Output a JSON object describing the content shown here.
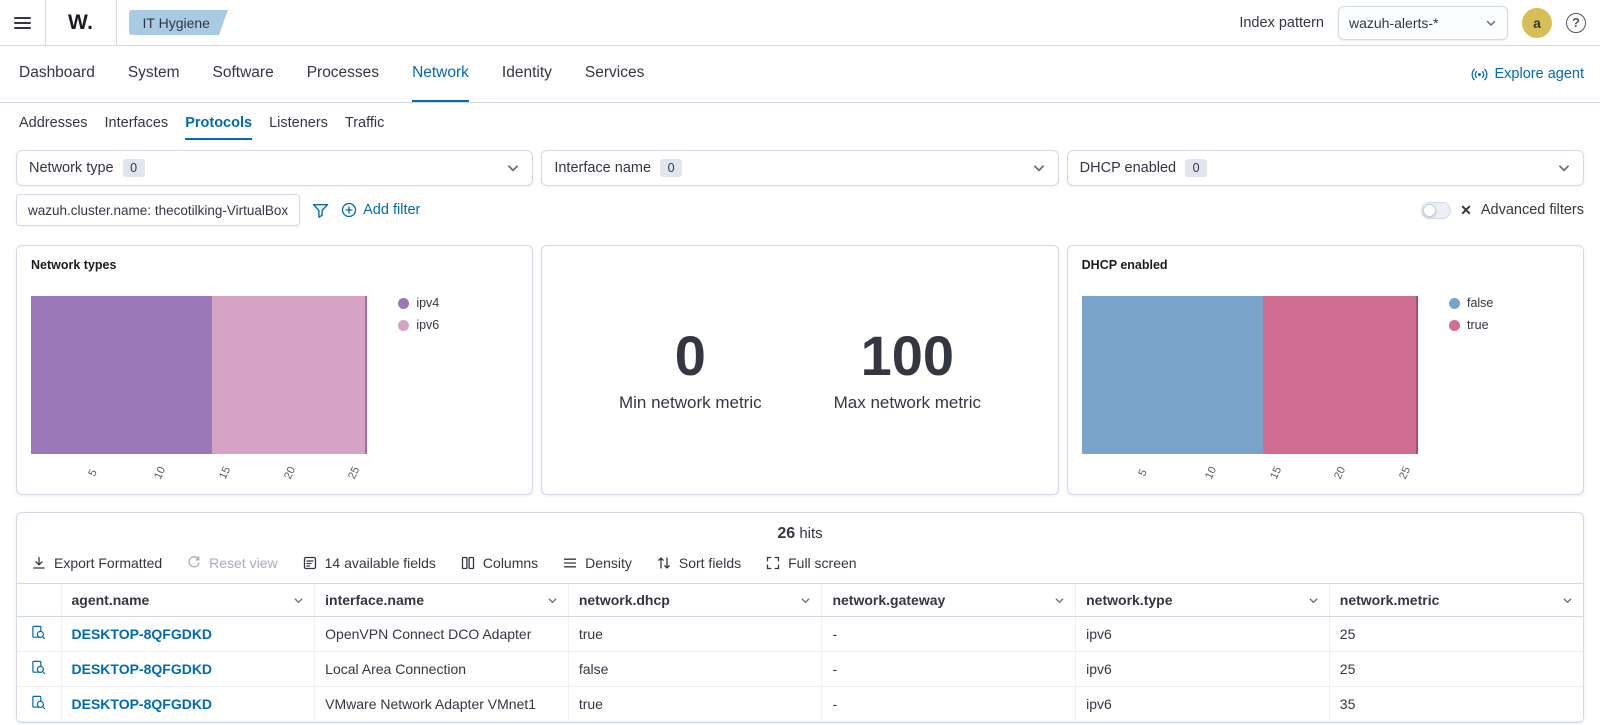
{
  "topbar": {
    "logo": "W.",
    "breadcrumb": "IT Hygiene",
    "index_pattern_label": "Index pattern",
    "index_pattern_value": "wazuh-alerts-*",
    "avatar_initial": "a",
    "help_glyph": "?"
  },
  "nav": {
    "tabs": [
      {
        "label": "Dashboard",
        "active": false
      },
      {
        "label": "System",
        "active": false
      },
      {
        "label": "Software",
        "active": false
      },
      {
        "label": "Processes",
        "active": false
      },
      {
        "label": "Network",
        "active": true
      },
      {
        "label": "Identity",
        "active": false
      },
      {
        "label": "Services",
        "active": false
      }
    ],
    "explore_agent_label": "Explore agent"
  },
  "subnav": {
    "tabs": [
      {
        "label": "Addresses",
        "active": false
      },
      {
        "label": "Interfaces",
        "active": false
      },
      {
        "label": "Protocols",
        "active": true
      },
      {
        "label": "Listeners",
        "active": false
      },
      {
        "label": "Traffic",
        "active": false
      }
    ]
  },
  "filters": {
    "dropdowns": [
      {
        "label": "Network type",
        "count": "0"
      },
      {
        "label": "Interface name",
        "count": "0"
      },
      {
        "label": "DHCP enabled",
        "count": "0"
      }
    ],
    "pill": "wazuh.cluster.name: thecotilking-VirtualBox",
    "add_filter_label": "Add filter",
    "advanced_filters_label": "Advanced filters",
    "switch_off_glyph": "✕"
  },
  "chart_data": [
    {
      "type": "bar",
      "title": "Network types",
      "orientation": "horizontal-stacked",
      "axis_max": 27,
      "x_ticks": [
        5,
        10,
        15,
        20,
        25
      ],
      "legend_position": "right",
      "series": [
        {
          "name": "ipv4",
          "value": 14,
          "color": "#9c77b9"
        },
        {
          "name": "ipv6",
          "value": 12,
          "color": "#d5a3c4"
        }
      ]
    },
    {
      "type": "metric",
      "values": [
        {
          "value": 0,
          "label": "Min network metric"
        },
        {
          "value": 100,
          "label": "Max network metric"
        }
      ]
    },
    {
      "type": "bar",
      "title": "DHCP enabled",
      "orientation": "horizontal-stacked",
      "axis_max": 27,
      "x_ticks": [
        5,
        10,
        15,
        20,
        25
      ],
      "legend_position": "right",
      "series": [
        {
          "name": "false",
          "value": 14,
          "color": "#7aa3cc"
        },
        {
          "name": "true",
          "value": 12,
          "color": "#d26d92"
        }
      ]
    }
  ],
  "table": {
    "hits_count": "26",
    "hits_label": "hits",
    "toolbar": [
      {
        "label": "Export Formatted",
        "icon": "download-icon",
        "enabled": true
      },
      {
        "label": "Reset view",
        "icon": "refresh-icon",
        "enabled": false
      },
      {
        "label": "14 available fields",
        "icon": "fields-icon",
        "enabled": true
      },
      {
        "label": "Columns",
        "icon": "columns-icon",
        "enabled": true
      },
      {
        "label": "Density",
        "icon": "density-icon",
        "enabled": true
      },
      {
        "label": "Sort fields",
        "icon": "sort-icon",
        "enabled": true
      },
      {
        "label": "Full screen",
        "icon": "fullscreen-icon",
        "enabled": true
      }
    ],
    "columns": [
      "agent.name",
      "interface.name",
      "network.dhcp",
      "network.gateway",
      "network.type",
      "network.metric"
    ],
    "rows": [
      {
        "agent": "DESKTOP-8QFGDKD",
        "interface": "OpenVPN Connect DCO Adapter",
        "dhcp": "true",
        "gateway": "-",
        "type": "ipv6",
        "metric": "25"
      },
      {
        "agent": "DESKTOP-8QFGDKD",
        "interface": "Local Area Connection",
        "dhcp": "false",
        "gateway": "-",
        "type": "ipv6",
        "metric": "25"
      },
      {
        "agent": "DESKTOP-8QFGDKD",
        "interface": "VMware Network Adapter VMnet1",
        "dhcp": "true",
        "gateway": "-",
        "type": "ipv6",
        "metric": "35"
      }
    ]
  }
}
